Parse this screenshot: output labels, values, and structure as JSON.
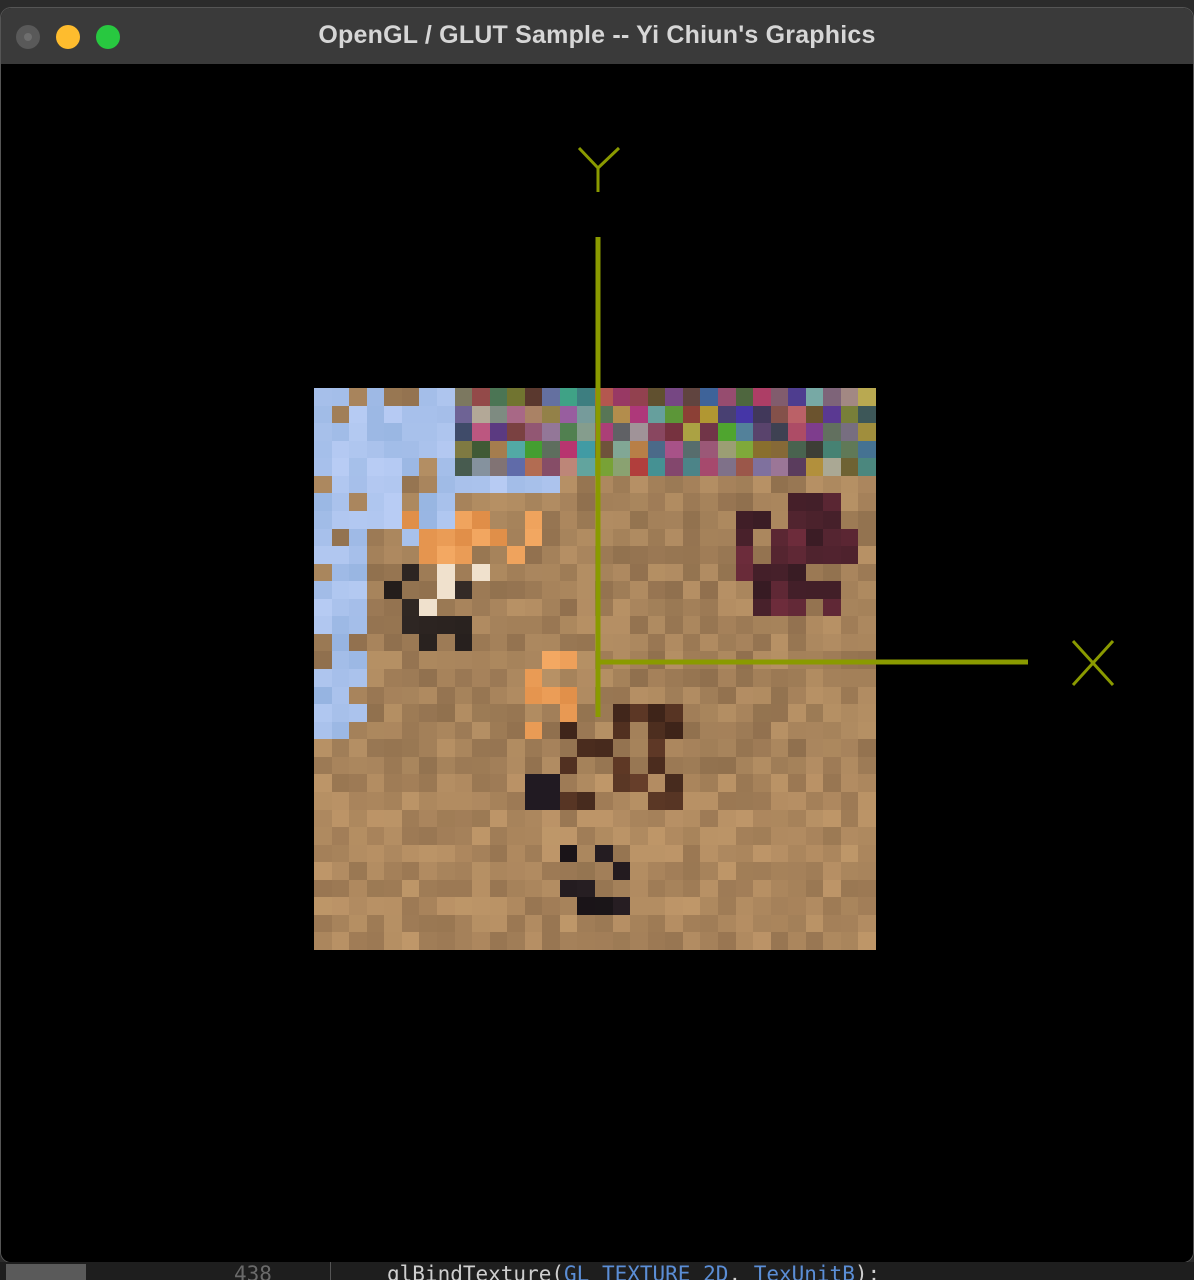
{
  "window": {
    "title": "OpenGL / GLUT Sample -- Yi Chiun's Graphics",
    "buttons": [
      "close-button",
      "minimize-button",
      "zoom-button"
    ]
  },
  "axes": {
    "color": "#8a9a00",
    "x_label": "X",
    "y_label": "Y"
  },
  "texture": {
    "description_colors": {
      "sky": "#a6c4ee",
      "fur": "#a4815a",
      "dark": "#1a1418",
      "orange": "#e39447"
    }
  },
  "editor": {
    "line_number": "438",
    "code_prefix": "glBindTexture(",
    "code_const": "GL_TEXTURE_2D",
    "code_sep": ", ",
    "code_arg": "TexUnitB",
    "code_suffix": ");"
  }
}
